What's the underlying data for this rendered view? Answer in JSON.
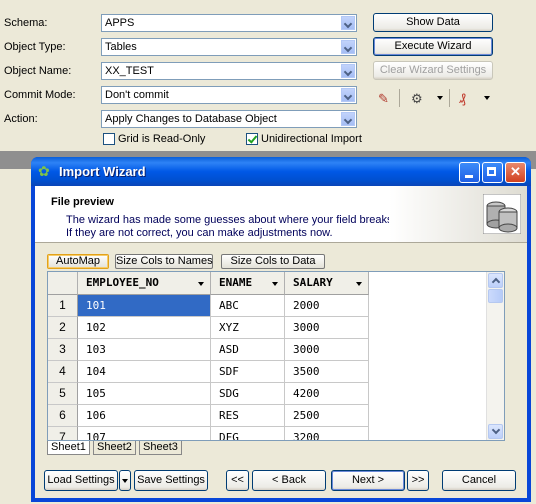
{
  "settings": {
    "rows": [
      {
        "label": "Schema:",
        "value": "APPS"
      },
      {
        "label": "Object Type:",
        "value": "Tables"
      },
      {
        "label": "Object Name:",
        "value": "XX_TEST"
      },
      {
        "label": "Commit Mode:",
        "value": "Don't commit"
      },
      {
        "label": "Action:",
        "value": "Apply Changes to Database Object"
      }
    ],
    "show_data": "Show Data",
    "execute_wizard": "Execute Wizard",
    "clear_wizard": "Clear Wizard Settings",
    "grid_read_only": {
      "label": "Grid is Read-Only",
      "checked": false
    },
    "unidirectional": {
      "label": "Unidirectional Import",
      "checked": true
    }
  },
  "wizard": {
    "title": "Import Wizard",
    "section_title": "File preview",
    "description_line1": "The wizard has made some guesses about where your field breaks occur.",
    "description_line2": "If they are not correct, you can make adjustments now.",
    "toolbar": {
      "automap": "AutoMap",
      "size_names": "Size Cols to Names",
      "size_data": "Size Cols to Data"
    },
    "columns": [
      "EMPLOYEE_NO",
      "ENAME",
      "SALARY"
    ],
    "rows": [
      {
        "n": "1",
        "cells": [
          "101",
          "ABC",
          "2000"
        ]
      },
      {
        "n": "2",
        "cells": [
          "102",
          "XYZ",
          "3000"
        ]
      },
      {
        "n": "3",
        "cells": [
          "103",
          "ASD",
          "3000"
        ]
      },
      {
        "n": "4",
        "cells": [
          "104",
          "SDF",
          "3500"
        ]
      },
      {
        "n": "5",
        "cells": [
          "105",
          "SDG",
          "4200"
        ]
      },
      {
        "n": "6",
        "cells": [
          "106",
          "RES",
          "2500"
        ]
      },
      {
        "n": "7",
        "cells": [
          "107",
          "DFG",
          "3200"
        ]
      }
    ],
    "sheets": [
      "Sheet1",
      "Sheet2",
      "Sheet3"
    ],
    "buttons": {
      "load_settings": "Load Settings",
      "save_settings": "Save Settings",
      "first": "<<",
      "back": "< Back",
      "next": "Next >",
      "last": ">>",
      "cancel": "Cancel"
    }
  },
  "colors": {
    "titlebar": "#0058e6",
    "selection": "#316ac5"
  }
}
